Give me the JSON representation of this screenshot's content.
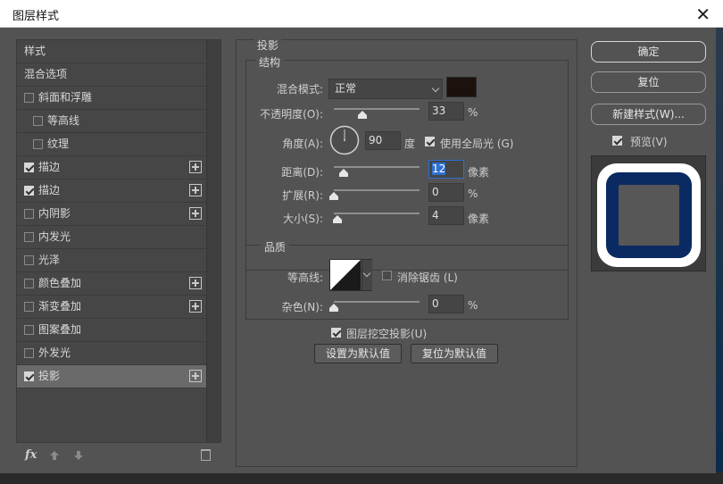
{
  "window": {
    "title": "图层样式",
    "close_glyph": "✕"
  },
  "left_panel": {
    "header": "样式",
    "blend_options": "混合选项",
    "items": [
      {
        "label": "斜面和浮雕",
        "checked": false,
        "indent": false,
        "plus": false
      },
      {
        "label": "等高线",
        "checked": false,
        "indent": true,
        "plus": false
      },
      {
        "label": "纹理",
        "checked": false,
        "indent": true,
        "plus": false
      },
      {
        "label": "描边",
        "checked": true,
        "indent": false,
        "plus": true
      },
      {
        "label": "描边",
        "checked": true,
        "indent": false,
        "plus": true
      },
      {
        "label": "内阴影",
        "checked": false,
        "indent": false,
        "plus": true
      },
      {
        "label": "内发光",
        "checked": false,
        "indent": false,
        "plus": false
      },
      {
        "label": "光泽",
        "checked": false,
        "indent": false,
        "plus": false
      },
      {
        "label": "颜色叠加",
        "checked": false,
        "indent": false,
        "plus": true
      },
      {
        "label": "渐变叠加",
        "checked": false,
        "indent": false,
        "plus": true
      },
      {
        "label": "图案叠加",
        "checked": false,
        "indent": false,
        "plus": false
      },
      {
        "label": "外发光",
        "checked": false,
        "indent": false,
        "plus": false
      },
      {
        "label": "投影",
        "checked": true,
        "indent": false,
        "plus": true,
        "selected": true
      }
    ],
    "footer": {
      "fx_label": "fx"
    }
  },
  "panel": {
    "title": "投影",
    "structure": {
      "title": "结构",
      "blend_mode_label": "混合模式:",
      "blend_mode_value": "正常",
      "shadow_color": "#1c120d",
      "opacity_label": "不透明度(O):",
      "opacity_value": "33",
      "opacity_unit": "%",
      "angle_label": "角度(A):",
      "angle_value": "90",
      "angle_unit": "度",
      "global_light_label": "使用全局光 (G)",
      "global_light_checked": true,
      "distance_label": "距离(D):",
      "distance_value": "12",
      "distance_unit": "像素",
      "spread_label": "扩展(R):",
      "spread_value": "0",
      "spread_unit": "%",
      "size_label": "大小(S):",
      "size_value": "4",
      "size_unit": "像素"
    },
    "quality": {
      "title": "品质",
      "contour_label": "等高线:",
      "antialias_label": "消除锯齿 (L)",
      "antialias_checked": false,
      "noise_label": "杂色(N):",
      "noise_value": "0",
      "noise_unit": "%"
    },
    "knockout_label": "图层挖空投影(U)",
    "knockout_checked": true,
    "set_default": "设置为默认值",
    "reset_default": "复位为默认值"
  },
  "right": {
    "ok": "确定",
    "reset": "复位",
    "new_style": "新建样式(W)...",
    "preview_label": "预览(V)",
    "preview_checked": true,
    "preview_colors": {
      "outer": "#ffffff",
      "ring": "#0b2a62",
      "inner": "#575757"
    }
  }
}
